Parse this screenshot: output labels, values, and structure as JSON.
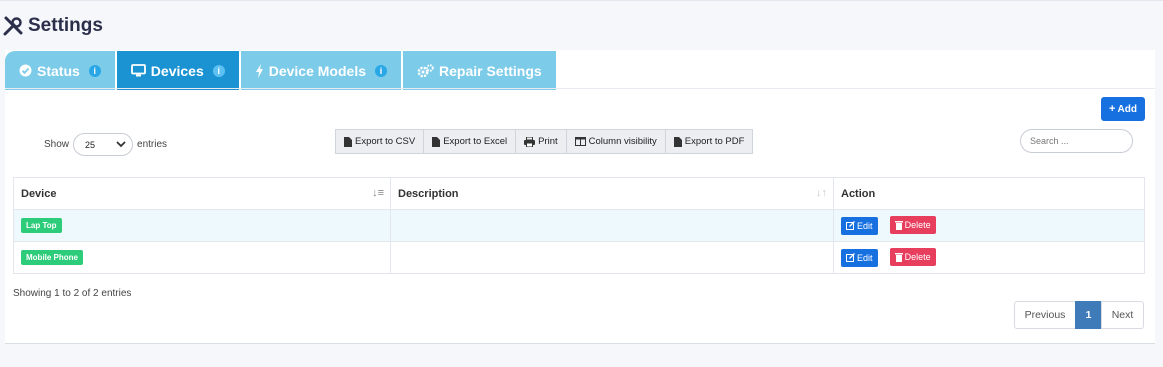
{
  "page": {
    "title": "Settings"
  },
  "tabs": [
    {
      "label": "Status",
      "icon": "check-circle-icon",
      "active": false
    },
    {
      "label": "Devices",
      "icon": "monitor-icon",
      "active": true
    },
    {
      "label": "Device Models",
      "icon": "bolt-icon",
      "active": false
    },
    {
      "label": "Repair Settings",
      "icon": "gears-icon",
      "active": false
    }
  ],
  "toolbar": {
    "add_label": "Add",
    "show_label": "Show",
    "entries_label": "entries",
    "page_size": "25",
    "export_buttons": [
      "Export to CSV",
      "Export to Excel",
      "Print",
      "Column visibility",
      "Export to PDF"
    ],
    "search_placeholder": "Search ..."
  },
  "table": {
    "columns": [
      "Device",
      "Description",
      "Action"
    ],
    "rows": [
      {
        "device": "Lap Top",
        "description": ""
      },
      {
        "device": "Mobile Phone",
        "description": ""
      }
    ],
    "edit_label": "Edit",
    "delete_label": "Delete"
  },
  "footer": {
    "info": "Showing 1 to 2 of 2 entries",
    "prev_label": "Previous",
    "current_page": "1",
    "next_label": "Next"
  },
  "colors": {
    "tab_inactive": "#7ccbe8",
    "tab_active": "#1b93d2",
    "primary": "#1770e0",
    "danger": "#e83e5e",
    "success": "#2ccc7a",
    "pager_active": "#3f7bb9"
  }
}
